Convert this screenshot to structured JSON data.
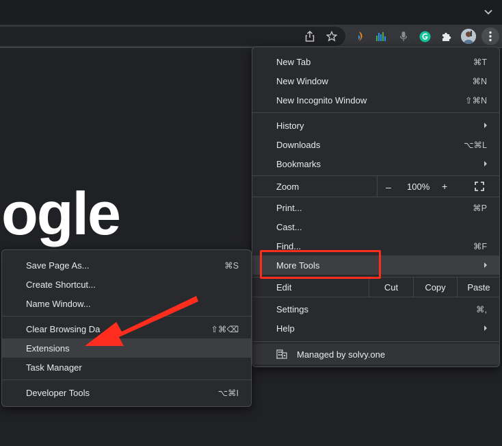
{
  "page": {
    "logo_text": "ogle"
  },
  "toolbar": {
    "icons": [
      "share-icon",
      "bookmark-star-icon",
      "extension-flame-icon",
      "extension-chart-icon",
      "microphone-icon",
      "grammarly-icon",
      "puzzle-extensions-icon",
      "profile-avatar",
      "kebab-menu-icon"
    ]
  },
  "main_menu": {
    "items": [
      {
        "label": "New Tab",
        "shortcut": "⌘T"
      },
      {
        "label": "New Window",
        "shortcut": "⌘N"
      },
      {
        "label": "New Incognito Window",
        "shortcut": "⇧⌘N"
      },
      {
        "label": "History",
        "shortcut": ""
      },
      {
        "label": "Downloads",
        "shortcut": "⌥⌘L"
      },
      {
        "label": "Bookmarks",
        "shortcut": ""
      },
      {
        "label": "Print...",
        "shortcut": "⌘P"
      },
      {
        "label": "Cast...",
        "shortcut": ""
      },
      {
        "label": "Find...",
        "shortcut": "⌘F"
      },
      {
        "label": "More Tools",
        "shortcut": ""
      },
      {
        "label": "Settings",
        "shortcut": "⌘,"
      },
      {
        "label": "Help",
        "shortcut": ""
      }
    ],
    "zoom": {
      "label": "Zoom",
      "minus": "–",
      "value": "100%",
      "plus": "+"
    },
    "edit": {
      "label": "Edit",
      "cut": "Cut",
      "copy": "Copy",
      "paste": "Paste"
    },
    "managed": {
      "label": "Managed by solvy.one"
    }
  },
  "sub_menu": {
    "items": [
      {
        "label": "Save Page As...",
        "shortcut": "⌘S"
      },
      {
        "label": "Create Shortcut...",
        "shortcut": ""
      },
      {
        "label": "Name Window...",
        "shortcut": ""
      },
      {
        "label": "Clear Browsing Da",
        "shortcut": "⇧⌘⌫"
      },
      {
        "label": "Extensions",
        "shortcut": ""
      },
      {
        "label": "Task Manager",
        "shortcut": ""
      },
      {
        "label": "Developer Tools",
        "shortcut": "⌥⌘I"
      }
    ]
  },
  "colors": {
    "background": "#202124",
    "menu_bg": "#292a2d",
    "highlight": "#3d3e42",
    "annotation_red": "#ff2d1e"
  }
}
